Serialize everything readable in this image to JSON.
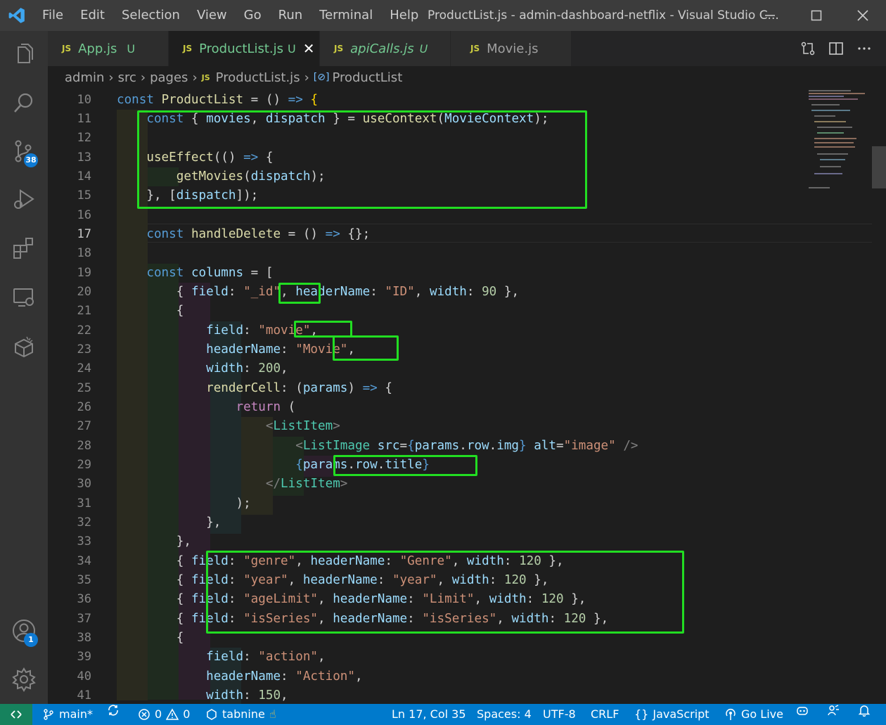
{
  "titlebar": {
    "menu": [
      "File",
      "Edit",
      "Selection",
      "View",
      "Go",
      "Run",
      "Terminal",
      "Help"
    ],
    "title": "ProductList.js - admin-dashboard-netflix - Visual Studio C..."
  },
  "activitybar": {
    "scm_badge": "38",
    "accounts_badge": "1"
  },
  "tabs": [
    {
      "label": "App.js",
      "status": "U"
    },
    {
      "label": "ProductList.js",
      "status": "U"
    },
    {
      "label": "apiCalls.js",
      "status": "U"
    },
    {
      "label": "Movie.js",
      "status": ""
    }
  ],
  "breadcrumb": [
    "admin",
    "src",
    "pages",
    "ProductList.js",
    "ProductList"
  ],
  "editor": {
    "line_numbers": [
      "10",
      "11",
      "12",
      "13",
      "14",
      "15",
      "16",
      "17",
      "18",
      "19",
      "20",
      "21",
      "22",
      "23",
      "24",
      "25",
      "26",
      "27",
      "28",
      "29",
      "30",
      "31",
      "32",
      "33",
      "34",
      "35",
      "36",
      "37",
      "38",
      "39",
      "40",
      "41"
    ],
    "current_line": "17"
  },
  "statusbar": {
    "branch": "main*",
    "errors": "0",
    "warnings": "0",
    "tabnine": "tabnine",
    "position": "Ln 17, Col 35",
    "spaces": "Spaces: 4",
    "encoding": "UTF-8",
    "eol": "CRLF",
    "language": "JavaScript",
    "golive": "Go Live"
  },
  "colors": {
    "accent": "#007acc",
    "highlight_box": "#22dd22",
    "untracked": "#73c991"
  }
}
